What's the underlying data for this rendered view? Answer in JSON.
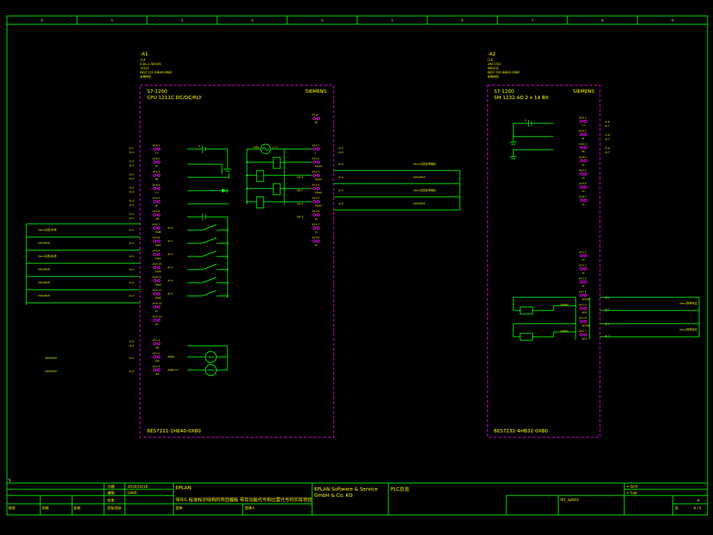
{
  "colors": {
    "background": "#000000",
    "line": "#00ff00",
    "text": "#ffff00",
    "terminal": "#ff00ff",
    "device": "#ff00ff",
    "frame": "#00ff00",
    "grid_text": "#ffff66"
  },
  "frame": {
    "columns": [
      "0",
      "1",
      "2",
      "3",
      "4",
      "5",
      "6",
      "7",
      "8",
      "9"
    ],
    "row_letter": "S"
  },
  "a1": {
    "tag": "-A1",
    "info": [
      "/3.4",
      "S DI=1 RLY/2AI",
      "1211C",
      "6ES7 211-1HE40-0XB0",
      "安装构型"
    ],
    "family": "S7-1200",
    "model": "CPU 1211C DC/DC/RLY",
    "brand": "SIEMENS",
    "order_no": "6ES7211-1HE40-0XB0",
    "power_terminals": [
      {
        "id": "-X10.1",
        "pin": "L+"
      },
      {
        "id": "-X10.2",
        "pin": "M"
      },
      {
        "id": "-X10.3",
        "pin": "PE"
      },
      {
        "id": "-X10.4",
        "pin": "L+"
      },
      {
        "id": "-X10.5",
        "pin": "M"
      },
      {
        "id": "-X10.6",
        "pin": "1M"
      }
    ],
    "di_terminals": [
      {
        "id": "-X10.7",
        "pin": "DIa0",
        "addr": "I0.0"
      },
      {
        "id": "-X10.8",
        "pin": "DIa1",
        "addr": "I0.1"
      },
      {
        "id": "-X10.9",
        "pin": "DIa2",
        "addr": "I0.2"
      },
      {
        "id": "-X10.10",
        "pin": "DIa3",
        "addr": "I0.3"
      },
      {
        "id": "-X10.11",
        "pin": "DIa4",
        "addr": "I0.4"
      },
      {
        "id": "-X10.12",
        "pin": "DIa5",
        "addr": "I0.5"
      },
      {
        "id": "-X10.13",
        "pin": "nc"
      },
      {
        "id": "-X10.14",
        "pin": "nc"
      }
    ],
    "ai_terminals": [
      {
        "id": "-X11.1",
        "pin": "2M"
      },
      {
        "id": "-X11.2",
        "pin": "AI0",
        "addr": "IW64"
      },
      {
        "id": "-X11.3",
        "pin": "AI1",
        "addr": "IW64+2"
      }
    ],
    "dq_terminals": [
      {
        "id": "-X12.1",
        "pin": "L"
      },
      {
        "id": "-X12.2",
        "pin": "DQa0",
        "addr": "Q0.0"
      },
      {
        "id": "-X12.3",
        "pin": "DQa1",
        "addr": "Q0.1"
      },
      {
        "id": "-X12.4",
        "pin": "DQa2",
        "addr": "Q0.2"
      },
      {
        "id": "-X12.5",
        "pin": "DQa3",
        "addr": "Q0.3"
      },
      {
        "id": "-X12.6",
        "pin": "nc"
      },
      {
        "id": "-X12.7",
        "pin": "nc"
      },
      {
        "id": "-X12.8",
        "pin": "nc"
      }
    ],
    "top_terminal": {
      "id": "-P1.6",
      "pin": "PE"
    },
    "supply_labels": {
      "pos": "+",
      "neg": "-",
      "m": "1M",
      "l": "L+",
      "n": "N"
    },
    "left_refs": [
      "/2.1",
      "/4.4",
      "/2.4",
      "/4.4",
      "/2.4",
      "/4.4",
      "/2.4",
      "/4.4",
      "/2.4",
      "/4.4",
      "/2.4",
      "/4.4",
      "/2.5",
      "/4.4"
    ],
    "left_boxes": [
      {
        "label": "Dev1远程/本地",
        "ref": "/4.4"
      },
      {
        "label": "RESERVE",
        "ref": "/4.4"
      },
      {
        "label": "Dev2远程/本地",
        "ref": "/4.4"
      },
      {
        "label": "RESERVE",
        "ref": "/4.4"
      },
      {
        "label": "RESERVE",
        "ref": "/4.4"
      },
      {
        "label": "RESERVE",
        "ref": "/4.4"
      }
    ],
    "ai_refs": [
      {
        "label": "RESERVE",
        "ref": "/4.4"
      },
      {
        "label": "RESERVE",
        "ref": "/4.4"
      }
    ],
    "right_refs": [
      "/2.5",
      "/4.4",
      "/4.4",
      "/4.4",
      "/4.4",
      "/4.4"
    ],
    "right_boxes": [
      "Dev1远程启停输出",
      "RESERVE",
      "Dev2远程启停输出",
      "RESERVE"
    ],
    "relay_label": "RES",
    "relay_label2": "L+1"
  },
  "a2": {
    "tag": "-A2",
    "info": [
      "/3.4",
      "2AO 1Tcd",
      "SM1232",
      "6ES7 232-4HB32-0XB0",
      "安装构型"
    ],
    "family": "S7-1200",
    "model": "SM 1232 AO 2 x 14 Bit",
    "brand": "SIEMENS",
    "order_no": "6ES7232-4HB32-0XB0",
    "top_terminals": [
      {
        "id": "-X10.1",
        "pin": "L+"
      },
      {
        "id": "-X10.2",
        "pin": "M"
      },
      {
        "id": "-X10.3",
        "pin": "PE"
      },
      {
        "id": "-X10.4",
        "pin": "nc"
      },
      {
        "id": "-X10.5",
        "pin": "nc"
      },
      {
        "id": "-X10.6",
        "pin": "nc"
      },
      {
        "id": "-X10.7",
        "pin": "nc"
      }
    ],
    "top_refs": [
      "/2.6",
      "/4.7",
      "/2.6",
      "/4.7",
      "/2.6",
      "/4.7"
    ],
    "ao_terminals": [
      {
        "id": "-X11.1",
        "pin": "nc"
      },
      {
        "id": "-X11.2",
        "pin": "nc"
      },
      {
        "id": "-X11.3",
        "pin": "nc"
      },
      {
        "id": "-X11.4",
        "pin": "AO0M"
      },
      {
        "id": "-X11.5",
        "pin": "AO0"
      },
      {
        "id": "-X11.6",
        "pin": "AO1M"
      },
      {
        "id": "-X11.7",
        "pin": "AO1"
      }
    ],
    "ao_addr": [
      "QW80",
      "QW82"
    ],
    "right_boxes": [
      {
        "label": "Dev1频率给定",
        "ref": "/4.7"
      },
      {
        "label": "Dev2频率给定",
        "ref": "/4.7"
      }
    ]
  },
  "title_block": {
    "company": "EPLAN",
    "partner": "EPLAN Software & Service GmbH & Co. KG",
    "project": "带IEC 标准标识结构的项目模板 带有功能代号和位置代号的实际项目",
    "page_desc": "PLC总览",
    "date_label": "日期",
    "date_value": "2019/10/18",
    "editor_label": "编辑",
    "editor_value": "DAVE",
    "check_label": "检查",
    "mod_label": "修改",
    "orig_label": "原始项目",
    "replace_label": "替换",
    "replaced_label": "替换人",
    "date2_label": "日期",
    "name_label": "名称",
    "eq_label": "= SCH",
    "loc_label": "+ Cab",
    "page_label": "页",
    "page_value": "4 / 5",
    "page_no": "4",
    "sheet_label": "IEC_tpl001"
  }
}
